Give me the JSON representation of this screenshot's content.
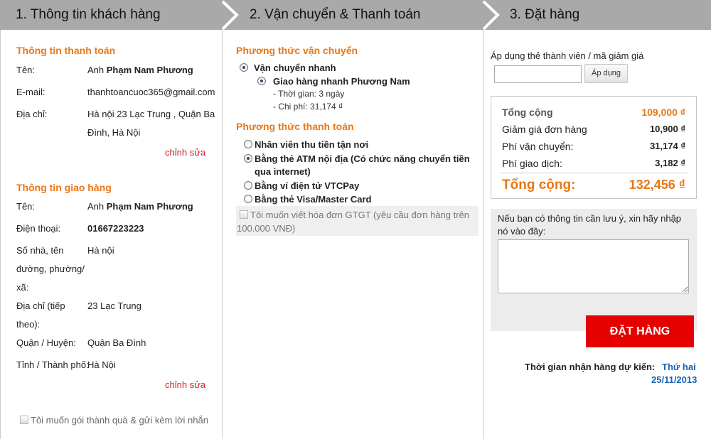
{
  "steps": [
    {
      "label": "1. Thông tin khách hàng"
    },
    {
      "label": "2. Vận chuyển & Thanh toán"
    },
    {
      "label": "3. Đặt hàng"
    }
  ],
  "billing": {
    "title": "Thông tin thanh toán",
    "name_label": "Tên:",
    "name_prefix": "Anh ",
    "name_value": "Phạm Nam Phương",
    "email_label": "E-mail:",
    "email_value": "thanhtoancuoc365@gmail.com",
    "address_label": "Địa chỉ:",
    "address_line1": "Hà nội 23 Lạc Trung , Quận Ba",
    "address_line2": "Đình, Hà Nội",
    "edit_label": "chỉnh sửa"
  },
  "shipping_info": {
    "title": "Thông tin giao hàng",
    "name_label": "Tên:",
    "name_prefix": "Anh ",
    "name_value": "Phạm Nam Phương",
    "phone_label": "Điện thoại:",
    "phone_value": "01667223223",
    "street_label_1": "Số nhà, tên",
    "street_label_2": "đường, phường/",
    "street_label_3": "xã:",
    "street_value": "Hà nội",
    "address2_label_1": "Địa chỉ (tiếp",
    "address2_label_2": "theo):",
    "address2_value": "23 Lạc Trung",
    "district_label": "Quận / Huyện:",
    "district_value": "Quận Ba Đình",
    "city_label": "Tỉnh / Thành phố:",
    "city_value": "Hà Nội",
    "edit_label": "chỉnh sửa",
    "gift_label": "Tôi muốn gói thành quà & gửi kèm lời nhắn",
    "gift_checked": false
  },
  "shipping_method": {
    "title": "Phương thức vận chuyển",
    "option": "Vận chuyển nhanh",
    "sub_option": "Giao hàng nhanh Phương Nam",
    "time_text": "- Thời gian: 3 ngày",
    "cost_text": "- Chi phí: 31,174 ₫"
  },
  "payment_method": {
    "title": "Phương thức thanh toán",
    "options": [
      {
        "label": "Nhân viên thu tiền tận nơi",
        "selected": false
      },
      {
        "label_1": "Bằng thẻ ATM nội địa (Có chức năng chuyển tiền",
        "label_2": "qua internet)",
        "selected": true
      },
      {
        "label": "Bằng ví điện tử VTCPay",
        "selected": false
      },
      {
        "label": "Bằng thẻ Visa/Master Card",
        "selected": false
      }
    ],
    "invoice_label_1": "Tôi muốn viết hóa đơn GTGT (yêu cầu đơn hàng trên",
    "invoice_label_2": "100.000 VNĐ)"
  },
  "order": {
    "coupon_label": "Áp dụng thẻ thành viên / mã giảm giá",
    "coupon_value": "",
    "apply_button": "Áp dụng",
    "summary": {
      "subtotal_label": "Tổng cộng",
      "subtotal_value": "109,000 ₫",
      "discount_label": "Giảm giá đơn hàng",
      "discount_value": "10,900 ₫",
      "shipping_label": "Phí vận chuyển:",
      "shipping_value": "31,174 ₫",
      "transaction_label": "Phí giao dịch:",
      "transaction_value": "3,182 ₫",
      "total_label": "Tổng cộng:",
      "total_value": "132,456 ₫"
    },
    "note_label_1": "Nếu bạn có thông tin cần lưu ý, xin hãy nhập",
    "note_label_2": "nó vào đây:",
    "note_value": "",
    "place_order_button": "ĐẶT HÀNG",
    "delivery_label": "Thời gian nhận hàng dự kiến:",
    "delivery_day": "Thứ hai",
    "delivery_date": "25/11/2013"
  },
  "colors": {
    "header_bg": "#a9a9a9",
    "accent_orange": "#e77817",
    "link_red": "#cc1f1f",
    "button_red": "#e60000",
    "date_blue": "#1a62b5"
  }
}
